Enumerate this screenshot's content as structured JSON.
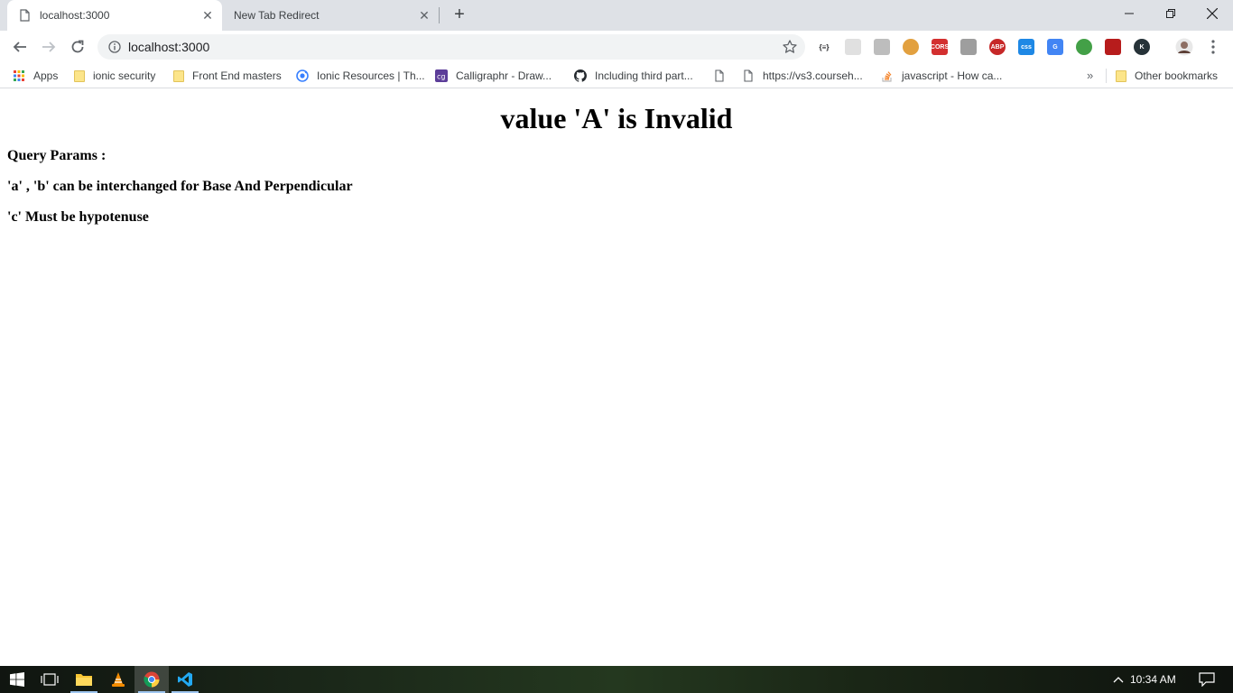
{
  "browser": {
    "tabs": [
      {
        "title": "localhost:3000",
        "active": true
      },
      {
        "title": "New Tab Redirect",
        "active": false
      }
    ],
    "address_bar": {
      "url": "localhost:3000"
    },
    "bookmarks": [
      {
        "label": "Apps",
        "icon": "apps-grid-icon"
      },
      {
        "label": "ionic security",
        "icon": "folder-icon"
      },
      {
        "label": "Front End masters",
        "icon": "folder-icon"
      },
      {
        "label": "Ionic Resources | Th...",
        "icon": "ionic-icon"
      },
      {
        "label": "Calligraphr - Draw...",
        "icon": "calligraphr-icon"
      },
      {
        "label": "Including third part...",
        "icon": "github-icon"
      },
      {
        "label": "https://vs3.courseh...",
        "icon": "page-icon"
      },
      {
        "label": "javascript - How ca...",
        "icon": "stackoverflow-icon"
      }
    ],
    "bookmarks_more": "»",
    "other_bookmarks": "Other bookmarks",
    "extensions": [
      {
        "name": "json-formatter-icon",
        "text": "{≡}",
        "color": "#ffffff"
      },
      {
        "name": "extension-cloud-icon",
        "text": "",
        "color": "#e0e0e0"
      },
      {
        "name": "extension-card-icon",
        "text": "",
        "color": "#bdbdbd"
      },
      {
        "name": "cookie-icon",
        "text": "",
        "color": "#e2a03f"
      },
      {
        "name": "cors-icon",
        "text": "CORS",
        "color": "#d32f2f"
      },
      {
        "name": "shield-icon",
        "text": "",
        "color": "#9e9e9e"
      },
      {
        "name": "adblock-plus-icon",
        "text": "ABP",
        "color": "#c62828"
      },
      {
        "name": "css-icon",
        "text": "css",
        "color": "#1e88e5"
      },
      {
        "name": "google-translate-icon",
        "text": "G",
        "color": "#4285f4"
      },
      {
        "name": "globe-icon",
        "text": "",
        "color": "#43a047"
      },
      {
        "name": "extension-red-icon",
        "text": "",
        "color": "#b71c1c"
      },
      {
        "name": "k-extension-icon",
        "text": "K",
        "color": "#263238"
      }
    ]
  },
  "page": {
    "heading": "value 'A' is Invalid",
    "lines": [
      "Query Params :",
      "'a' , 'b' can be interchanged for Base And Perpendicular",
      "'c' Must be hypotenuse"
    ]
  },
  "taskbar": {
    "clock": "10:34 AM"
  }
}
